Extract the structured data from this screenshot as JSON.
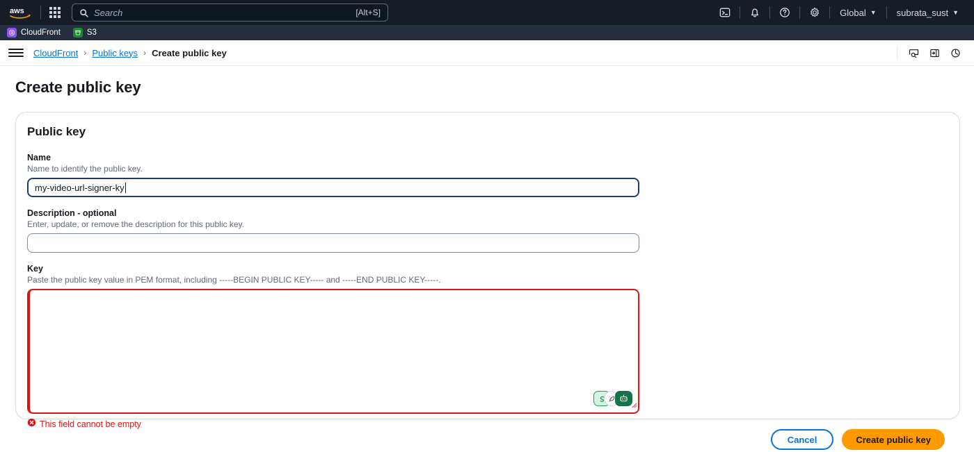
{
  "topnav": {
    "logo_alt": "aws",
    "search": {
      "placeholder": "Search",
      "shortcut": "[Alt+S]"
    },
    "region_label": "Global",
    "account_label": "subrata_sust",
    "icons": [
      "cloudshell-icon",
      "notifications-bell-icon",
      "help-question-icon",
      "settings-gear-icon"
    ]
  },
  "servicebar": {
    "items": [
      {
        "label": "CloudFront",
        "icon": "cloudfront-icon",
        "color": "#8c4fff"
      },
      {
        "label": "S3",
        "icon": "s3-bucket-icon",
        "color": "#1b8a2f"
      }
    ]
  },
  "breadcrumb": {
    "items": [
      {
        "label": "CloudFront",
        "link": true
      },
      {
        "label": "Public keys",
        "link": true
      },
      {
        "label": "Create public key",
        "link": false
      }
    ],
    "separator": "›"
  },
  "page": {
    "title": "Create public key"
  },
  "card": {
    "title": "Public key",
    "name_field": {
      "label": "Name",
      "hint": "Name to identify the public key.",
      "value": "my-video-url-signer-ky"
    },
    "description_field": {
      "label": "Description - optional",
      "hint": "Enter, update, or remove the description for this public key.",
      "value": "",
      "placeholder": ""
    },
    "key_field": {
      "label": "Key",
      "hint": "Paste the public key value in PEM format, including -----BEGIN PUBLIC KEY----- and -----END PUBLIC KEY-----.",
      "value": "",
      "error": "This field cannot be empty"
    }
  },
  "footer": {
    "cancel_label": "Cancel",
    "submit_label": "Create public key"
  },
  "colors": {
    "aws_orange": "#ff9900",
    "link_blue": "#0972d3",
    "error_red": "#d91515",
    "nav_dark": "#161d26",
    "service_bar": "#232f3e"
  }
}
